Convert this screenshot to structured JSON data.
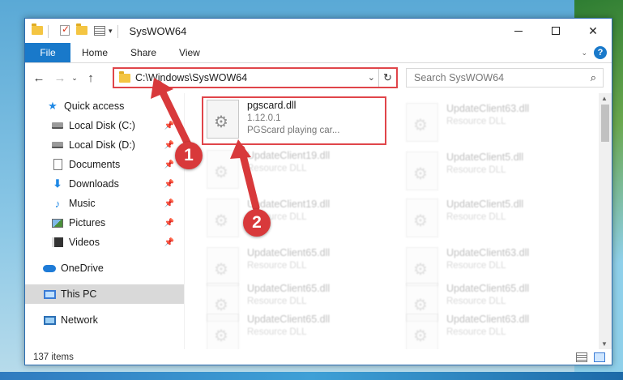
{
  "window": {
    "title": "SysWOW64",
    "controls": {
      "minimize": "",
      "maximize": "",
      "close": "✕"
    }
  },
  "ribbon": {
    "file": "File",
    "tabs": [
      "Home",
      "Share",
      "View"
    ],
    "help": "?"
  },
  "address": {
    "path": "C:\\Windows\\SysWOW64",
    "search_placeholder": "Search SysWOW64"
  },
  "sidebar": {
    "items": [
      {
        "label": "Quick access",
        "icon": "star-icon",
        "pinned": false
      },
      {
        "label": "Local Disk (C:)",
        "icon": "drive-icon",
        "pinned": true
      },
      {
        "label": "Local Disk (D:)",
        "icon": "drive-icon",
        "pinned": true
      },
      {
        "label": "Documents",
        "icon": "documents-icon",
        "pinned": true
      },
      {
        "label": "Downloads",
        "icon": "downloads-icon",
        "pinned": true
      },
      {
        "label": "Music",
        "icon": "music-icon",
        "pinned": true
      },
      {
        "label": "Pictures",
        "icon": "pictures-icon",
        "pinned": true
      },
      {
        "label": "Videos",
        "icon": "videos-icon",
        "pinned": true
      },
      {
        "label": "OneDrive",
        "icon": "onedrive-icon",
        "pinned": false
      },
      {
        "label": "This PC",
        "icon": "this-pc-icon",
        "pinned": false,
        "selected": true
      },
      {
        "label": "Network",
        "icon": "network-icon",
        "pinned": false
      }
    ]
  },
  "files": {
    "highlighted": {
      "name": "pgscard.dll",
      "version": "1.12.0.1",
      "description": "PGScard playing car..."
    },
    "left_column": [
      {
        "name": "UpdateClient19.dll",
        "type": "Resource DLL"
      },
      {
        "name": "UpdateClient19.dll",
        "type": "Resource DLL"
      },
      {
        "name": "UpdateClient65.dll",
        "type": "Resource DLL"
      },
      {
        "name": "UpdateClient65.dll",
        "type": "Resource DLL"
      },
      {
        "name": "UpdateClient65.dll",
        "type": "Resource DLL"
      }
    ],
    "right_column": [
      {
        "name": "UpdateClient63.dll",
        "type": "Resource DLL"
      },
      {
        "name": "UpdateClient5.dll",
        "type": "Resource DLL"
      },
      {
        "name": "UpdateClient5.dll",
        "type": "Resource DLL"
      },
      {
        "name": "UpdateClient63.dll",
        "type": "Resource DLL"
      },
      {
        "name": "UpdateClient65.dll",
        "type": "Resource DLL"
      },
      {
        "name": "UpdateClient63.dll",
        "type": "Resource DLL"
      }
    ]
  },
  "status": {
    "item_count": "137 items"
  },
  "annotations": {
    "badge1": "1",
    "badge2": "2",
    "color": "#d8393b"
  }
}
